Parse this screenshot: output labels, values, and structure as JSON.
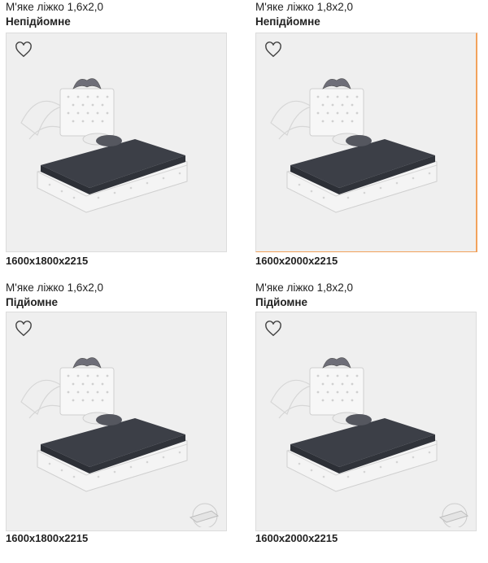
{
  "products": [
    {
      "title": "М'яке ліжко 1,6х2,0",
      "type": "Непідйомне",
      "size": "1600x1800x2215",
      "wishlist_icon": "heart-outline-icon"
    },
    {
      "title": "М'яке ліжко 1,8х2,0",
      "type": "Непідйомне",
      "size": "1600x2000x2215",
      "wishlist_icon": "heart-outline-icon"
    },
    {
      "title": "М'яке ліжко 1,6х2,0",
      "type": "Підйомне",
      "size": "1600x1800x2215",
      "wishlist_icon": "heart-outline-icon"
    },
    {
      "title": "М'яке ліжко 1,8х2,0",
      "type": "Підйомне",
      "size": "1600x2000x2215",
      "wishlist_icon": "heart-outline-icon"
    }
  ],
  "colors": {
    "frame_bg": "#efefef",
    "frame_border": "#dcdcdc",
    "accent": "#f2a25c"
  }
}
